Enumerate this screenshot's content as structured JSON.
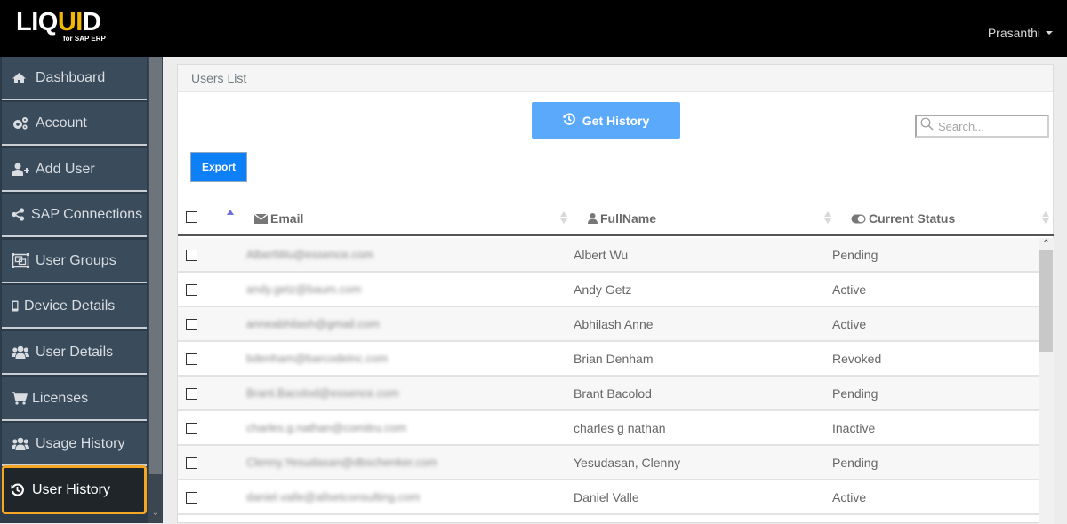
{
  "header": {
    "logo_main_left": "LIQ",
    "logo_main_accent": "UI",
    "logo_main_right": "D",
    "logo_sub": "for SAP ERP",
    "user_name": "Prasanthi"
  },
  "sidebar": {
    "items": [
      {
        "label": "Dashboard",
        "icon": "home-icon"
      },
      {
        "label": "Account",
        "icon": "gears-icon"
      },
      {
        "label": "Add User",
        "icon": "user-plus-icon"
      },
      {
        "label": "SAP Connections",
        "icon": "share-icon"
      },
      {
        "label": "User Groups",
        "icon": "object-group-icon"
      },
      {
        "label": "Device Details",
        "icon": "mobile-icon"
      },
      {
        "label": "User Details",
        "icon": "users-icon"
      },
      {
        "label": "Licenses",
        "icon": "cart-icon"
      },
      {
        "label": "Usage History",
        "icon": "users-icon"
      },
      {
        "label": "User History",
        "icon": "history-icon",
        "active": true
      }
    ]
  },
  "panel": {
    "title": "Users List",
    "get_history_label": "Get History",
    "export_label": "Export",
    "search_placeholder": "Search..."
  },
  "table": {
    "columns": [
      "Email",
      "FullName",
      "Current Status"
    ],
    "sorted_column": "Email",
    "sort_direction": "ascending",
    "rows": [
      {
        "email": "AlbertWu@essence.com",
        "name": "Albert Wu",
        "status": "Pending"
      },
      {
        "email": "andy.getz@baum.com",
        "name": "Andy Getz",
        "status": "Active"
      },
      {
        "email": "anneabhilash@gmail.com",
        "name": "Abhilash Anne",
        "status": "Active"
      },
      {
        "email": "bdenham@barcodeinc.com",
        "name": "Brian Denham",
        "status": "Revoked"
      },
      {
        "email": "Brant.Bacolod@essence.com",
        "name": "Brant Bacolod",
        "status": "Pending"
      },
      {
        "email": "charles.g.nathan@comitru.com",
        "name": "charles g nathan",
        "status": "Inactive"
      },
      {
        "email": "Clenny.Yesudasan@dbschenker.com",
        "name": "Yesudasan, Clenny",
        "status": "Pending"
      },
      {
        "email": "daniel.valle@allsetconsulting.com",
        "name": "Daniel Valle",
        "status": "Active"
      }
    ]
  },
  "colors": {
    "topbar": "#000000",
    "sidebar": "#3a4b5b",
    "active_border": "#f5a623",
    "get_history": "#5aa9fb",
    "export": "#0d80f8",
    "logo_accent": "#f2b705"
  }
}
